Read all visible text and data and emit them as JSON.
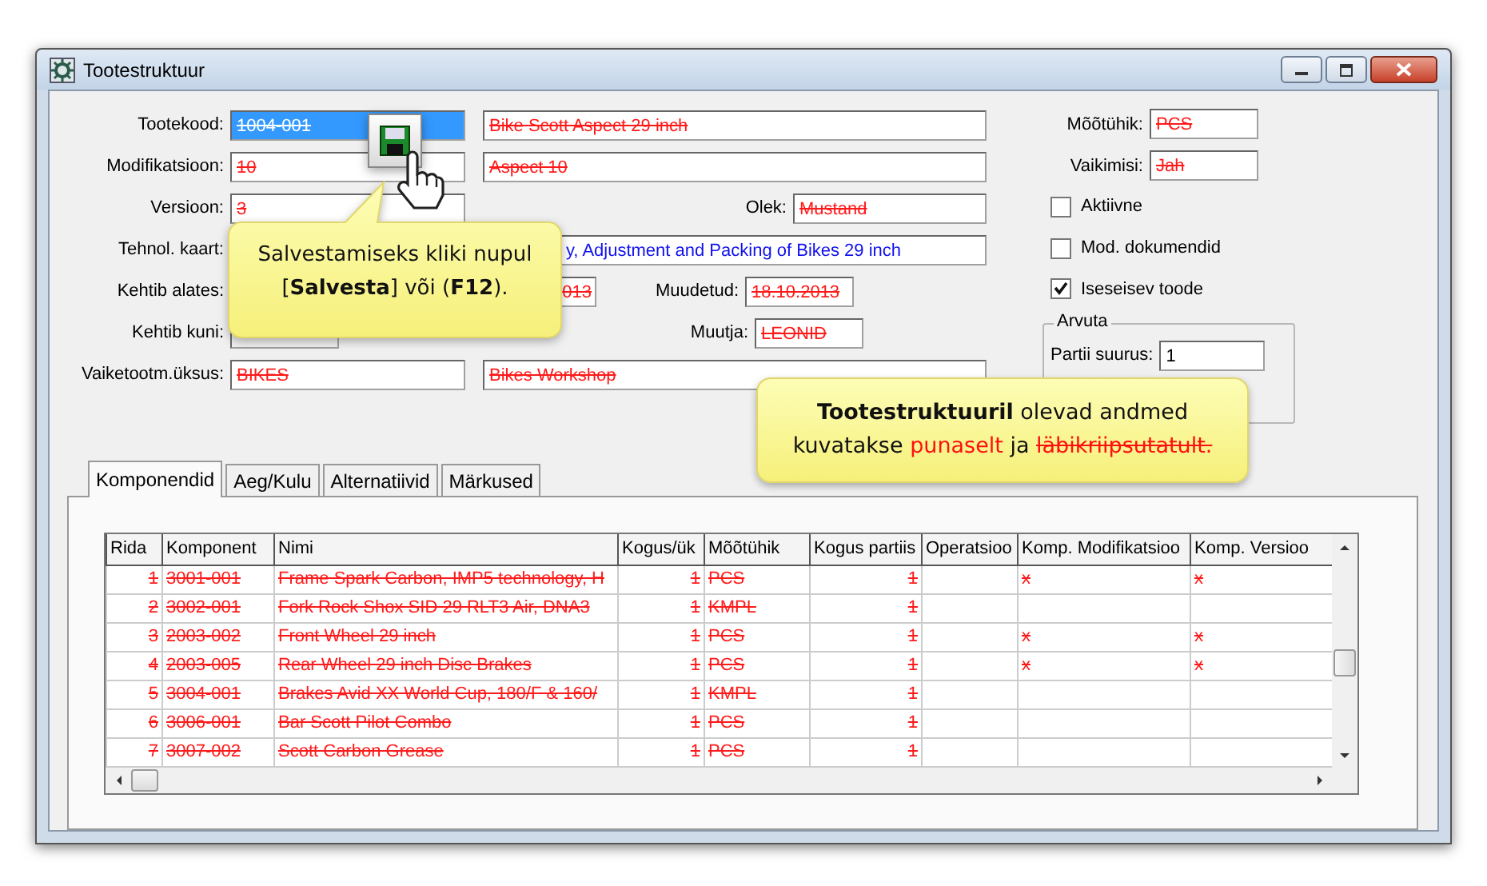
{
  "window": {
    "title": "Tootestruktuur"
  },
  "form": {
    "rows": [
      {
        "label": "Tootekood:",
        "kind": "pair",
        "values": [
          {
            "text": "1004-001",
            "deleted": true,
            "highlighted": true
          },
          {
            "text": "Bike Scott Aspect 29 inch",
            "deleted": true,
            "highlighted": false
          }
        ]
      },
      {
        "label": "Modifikatsioon:",
        "kind": "pair",
        "values": [
          {
            "text": "10",
            "deleted": true,
            "highlighted": false
          },
          {
            "text": "Aspect 10",
            "deleted": true,
            "highlighted": false
          }
        ]
      },
      {
        "label": "Versioon:",
        "kind": "side",
        "values": [
          {
            "text": "3",
            "deleted": true,
            "highlighted": false
          }
        ],
        "side": {
          "label": "Olek:",
          "value": {
            "text": "Mustand",
            "deleted": true
          }
        }
      },
      {
        "label": "Tehnol. kaart:",
        "kind": "pair_cov",
        "values": [
          {
            "text": "y, Adjustment and Packing of Bikes 29 inch",
            "deleted": false,
            "highlighted": false
          }
        ]
      },
      {
        "label": "Kehtib alates:",
        "kind": "date",
        "values": [
          {
            "text": "013",
            "deleted": true,
            "highlighted": false
          }
        ],
        "side": {
          "label": "Muudetud:",
          "value": {
            "text": "18.10.2013",
            "deleted": true
          }
        }
      },
      {
        "label": "Kehtib kuni:",
        "kind": "date_side",
        "side": {
          "label": "Muutja:",
          "value": {
            "text": "LEONID",
            "deleted": true
          }
        }
      },
      {
        "label": "Vaiketootm.üksus:",
        "kind": "pair",
        "values": [
          {
            "text": "BIKES",
            "deleted": true,
            "highlighted": false
          },
          {
            "text": "Bikes Workshop",
            "deleted": true,
            "highlighted": false
          }
        ]
      }
    ]
  },
  "unit_fields": [
    {
      "label": "Mõõtühik:",
      "value": {
        "text": "PCS",
        "deleted": true
      }
    },
    {
      "label": "Vaikimisi:",
      "value": {
        "text": "Jah",
        "deleted": true
      }
    }
  ],
  "checkboxes": [
    {
      "label": "Aktiivne",
      "checked": false
    },
    {
      "label": "Mod. dokumendid",
      "checked": false
    },
    {
      "label": "Iseseisev toode",
      "checked": true
    }
  ],
  "group": {
    "title": "Arvuta",
    "field": {
      "label": "Partii suurus:",
      "value": "1"
    }
  },
  "tabs": [
    {
      "label": "Komponendid",
      "selected": true
    },
    {
      "label": "Aeg/Kulu",
      "selected": false
    },
    {
      "label": "Alternatiivid",
      "selected": false
    },
    {
      "label": "Märkused",
      "selected": false
    }
  ],
  "table": {
    "columns": [
      "Rida",
      "Komponent",
      "Nimi",
      "Kogus/ük",
      "Mõõtühik",
      "Kogus partiis",
      "Operatsioo",
      "Komp. Modifikatsioo",
      "Komp. Versioo"
    ],
    "rows": [
      {
        "deleted": true,
        "cells": [
          "1",
          "3001-001",
          "Frame Spark Carbon, IMP5 technology, H",
          "1",
          "PCS",
          "1",
          null,
          "x",
          "x"
        ]
      },
      {
        "deleted": true,
        "cells": [
          "2",
          "3002-001",
          "Fork Rock Shox SID 29 RLT3 Air, DNA3",
          "1",
          "KMPL",
          "1",
          null,
          null,
          null
        ]
      },
      {
        "deleted": true,
        "cells": [
          "3",
          "2003-002",
          "Front Wheel 29 inch",
          "1",
          "PCS",
          "1",
          null,
          "x",
          "x"
        ]
      },
      {
        "deleted": true,
        "cells": [
          "4",
          "2003-005",
          "Rear Wheel 29 inch Disc Brakes",
          "1",
          "PCS",
          "1",
          null,
          "x",
          "x"
        ]
      },
      {
        "deleted": true,
        "cells": [
          "5",
          "3004-001",
          "Brakes Avid XX World Cup, 180/F & 160/",
          "1",
          "KMPL",
          "1",
          null,
          null,
          null
        ]
      },
      {
        "deleted": true,
        "cells": [
          "6",
          "3006-001",
          "Bar Scott Pilot Combo",
          "1",
          "PCS",
          "1",
          null,
          null,
          null
        ]
      },
      {
        "deleted": true,
        "cells": [
          "7",
          "3007-002",
          "Scott Carbon Grease",
          "1",
          "PCS",
          "1",
          null,
          null,
          null
        ]
      }
    ]
  },
  "callouts": [
    {
      "kind": "pointer",
      "text": "Salvestamiseks kliki nupul\n[**Salvesta**] või (**F12**)."
    },
    {
      "kind": "plain",
      "parts": [
        {
          "kind": "bold",
          "text": "Tootestruktuuril"
        },
        {
          "kind": "plain",
          "text": " olevad andmed\nkuvatakse "
        },
        {
          "kind": "red",
          "text": "punaselt"
        },
        {
          "kind": "plain",
          "text": " ja "
        },
        {
          "kind": "strike",
          "text": "läbikriipsutatult."
        }
      ]
    }
  ]
}
